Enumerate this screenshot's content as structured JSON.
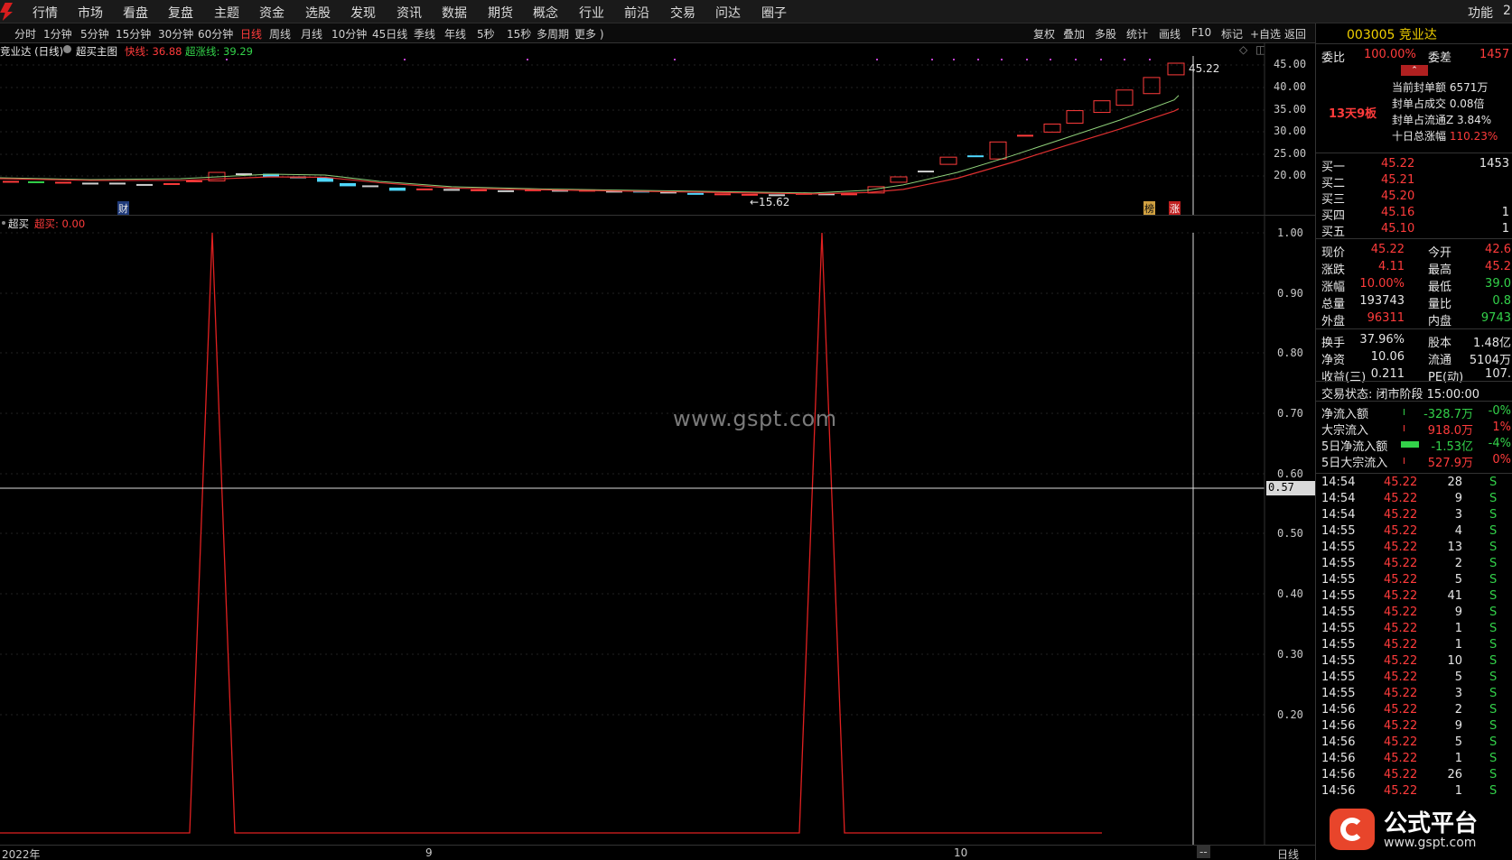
{
  "menu": {
    "items": [
      "行情",
      "市场",
      "看盘",
      "复盘",
      "主题",
      "资金",
      "选股",
      "发现",
      "资讯",
      "数据",
      "期货",
      "概念",
      "行业",
      "前沿",
      "交易",
      "问达",
      "圈子"
    ],
    "right_items": [
      "功能",
      "2"
    ]
  },
  "toolbar": {
    "periods": [
      "分时",
      "1分钟",
      "5分钟",
      "15分钟",
      "30分钟",
      "60分钟",
      "日线",
      "周线",
      "月线",
      "10分钟",
      "45日线",
      "季线",
      "年线",
      "5秒",
      "15秒",
      "多周期",
      "更多 )"
    ],
    "active_period": "日线",
    "tools": [
      "复权",
      "叠加",
      "多股",
      "统计",
      "画线",
      "F10",
      "标记",
      "+自选",
      "返回"
    ]
  },
  "main_chart": {
    "title": "竞业达 (日线)",
    "indicator": "超买主图",
    "fast_label": "快线: 36.88",
    "super_label": "超涨线: 39.29",
    "price_axis": [
      "45.00",
      "40.00",
      "35.00",
      "30.00",
      "25.00",
      "20.00"
    ],
    "last_price_tag": "45.22",
    "low_price_tag": "←15.62",
    "marker_cai": "财",
    "marker_bang": "榜",
    "marker_zhang": "涨"
  },
  "sub_chart": {
    "title": "超买",
    "value_label": "超买: 0.00",
    "axis": [
      "1.00",
      "0.90",
      "0.80",
      "0.70",
      "0.60",
      "0.50",
      "0.40",
      "0.30",
      "0.20"
    ],
    "crosshair_value": "0.57"
  },
  "chart_data": {
    "type": "line",
    "title": "超买",
    "series": [
      {
        "name": "超买",
        "points": [
          [
            0,
            0
          ],
          [
            210,
            0
          ],
          [
            235,
            1
          ],
          [
            260,
            0
          ],
          [
            885,
            0
          ],
          [
            910,
            1
          ],
          [
            935,
            0
          ],
          [
            1220,
            0
          ]
        ]
      }
    ],
    "ylim": [
      0,
      1
    ],
    "x_ticks": [
      "2022年",
      "9",
      "10"
    ]
  },
  "bottom_axis": {
    "year": "2022年",
    "m9": "9",
    "m10": "10",
    "dash": "--",
    "period": "日线"
  },
  "quote": {
    "code_name": "003005 竞业达",
    "weibi_label": "委比",
    "weibi": "100.00%",
    "weicha_label": "委差",
    "weicha": "1457",
    "board_tag": "13天9板",
    "seal_amount": "当前封单额 6571万",
    "seal_ratio": "封单占成交 0.08倍",
    "seal_float": "封单占流通Z 3.84%",
    "ten_day": "十日总涨幅",
    "ten_day_val": "110.23%",
    "bids": [
      {
        "label": "买一",
        "price": "45.22",
        "vol": "1453"
      },
      {
        "label": "买二",
        "price": "45.21",
        "vol": ""
      },
      {
        "label": "买三",
        "price": "45.20",
        "vol": ""
      },
      {
        "label": "买四",
        "price": "45.16",
        "vol": "1"
      },
      {
        "label": "买五",
        "price": "45.10",
        "vol": "1"
      }
    ],
    "stats": [
      {
        "l1": "现价",
        "v1": "45.22",
        "l2": "今开",
        "v2": "42.6"
      },
      {
        "l1": "涨跌",
        "v1": "4.11",
        "l2": "最高",
        "v2": "45.2"
      },
      {
        "l1": "涨幅",
        "v1": "10.00%",
        "l2": "最低",
        "v2": "39.0"
      },
      {
        "l1": "总量",
        "v1": "193743",
        "l2": "量比",
        "v2": "0.8"
      },
      {
        "l1": "外盘",
        "v1": "96311",
        "l2": "内盘",
        "v2": "9743"
      }
    ],
    "stats2": [
      {
        "l1": "换手",
        "v1": "37.96%",
        "l2": "股本",
        "v2": "1.48亿"
      },
      {
        "l1": "净资",
        "v1": "10.06",
        "l2": "流通",
        "v2": "5104万"
      },
      {
        "l1": "收益(三)",
        "v1": "0.211",
        "l2": "PE(动)",
        "v2": "107."
      }
    ],
    "trade_status": "交易状态: 闭市阶段 15:00:00",
    "flows": [
      {
        "label": "净流入额",
        "value": "-328.7万",
        "pct": "-0%"
      },
      {
        "label": "大宗流入",
        "value": "918.0万",
        "pct": "1%"
      },
      {
        "label": "5日净流入额",
        "value": "-1.53亿",
        "pct": "-4%"
      },
      {
        "label": "5日大宗流入",
        "value": "527.9万",
        "pct": "0%"
      }
    ],
    "ticks": [
      {
        "t": "14:54",
        "p": "45.22",
        "v": "28",
        "f": "S"
      },
      {
        "t": "14:54",
        "p": "45.22",
        "v": "9",
        "f": "S"
      },
      {
        "t": "14:54",
        "p": "45.22",
        "v": "3",
        "f": "S"
      },
      {
        "t": "14:55",
        "p": "45.22",
        "v": "4",
        "f": "S"
      },
      {
        "t": "14:55",
        "p": "45.22",
        "v": "13",
        "f": "S"
      },
      {
        "t": "14:55",
        "p": "45.22",
        "v": "2",
        "f": "S"
      },
      {
        "t": "14:55",
        "p": "45.22",
        "v": "5",
        "f": "S"
      },
      {
        "t": "14:55",
        "p": "45.22",
        "v": "41",
        "f": "S"
      },
      {
        "t": "14:55",
        "p": "45.22",
        "v": "9",
        "f": "S"
      },
      {
        "t": "14:55",
        "p": "45.22",
        "v": "1",
        "f": "S"
      },
      {
        "t": "14:55",
        "p": "45.22",
        "v": "1",
        "f": "S"
      },
      {
        "t": "14:55",
        "p": "45.22",
        "v": "10",
        "f": "S"
      },
      {
        "t": "14:55",
        "p": "45.22",
        "v": "5",
        "f": "S"
      },
      {
        "t": "14:55",
        "p": "45.22",
        "v": "3",
        "f": "S"
      },
      {
        "t": "14:56",
        "p": "45.22",
        "v": "2",
        "f": "S"
      },
      {
        "t": "14:56",
        "p": "45.22",
        "v": "9",
        "f": "S"
      },
      {
        "t": "14:56",
        "p": "45.22",
        "v": "5",
        "f": "S"
      },
      {
        "t": "14:56",
        "p": "45.22",
        "v": "1",
        "f": "S"
      },
      {
        "t": "14:56",
        "p": "45.22",
        "v": "26",
        "f": "S"
      },
      {
        "t": "14:56",
        "p": "45.22",
        "v": "1",
        "f": "S"
      }
    ]
  },
  "watermark": "www.gspt.com",
  "brand": {
    "name": "公式平台",
    "url": "www.gspt.com"
  }
}
